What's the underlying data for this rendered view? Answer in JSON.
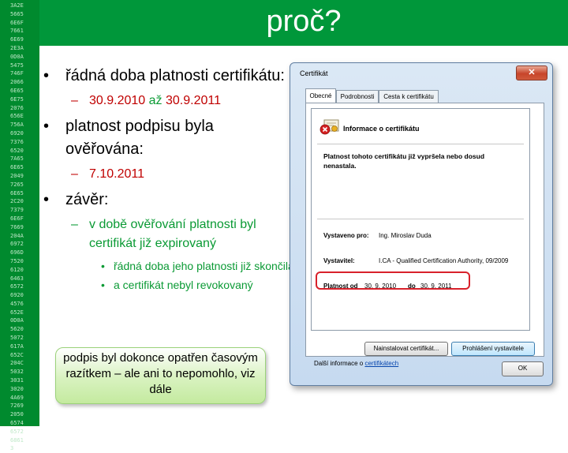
{
  "hex_strip": [
    "3A2E",
    "5665",
    "6E6F",
    "7661",
    "6E69",
    "2E3A",
    "0D0A",
    "5475",
    "746F",
    "2066",
    "6E65",
    "6E75",
    "2076",
    "656E",
    "756A",
    "6920",
    "7376",
    "6520",
    "7A65",
    "6E65",
    "2049",
    "7265",
    "6E65",
    "2C20",
    "7379",
    "6E6F",
    "7669",
    "204A",
    "6972",
    "696D",
    "7520",
    "6120",
    "6463",
    "6572",
    "6920",
    "4576",
    "652E",
    "0D0A",
    "5620",
    "5072",
    "617A",
    "652C",
    "204C",
    "5032",
    "3031",
    "3020",
    "4A69",
    "7269",
    "2050",
    "6574",
    "6572",
    "6861",
    "3"
  ],
  "title": "proč?",
  "bullets": [
    {
      "text": "řádná doba platnosti certifikátu:",
      "sub": {
        "parts": [
          "30.9.2010",
          " až ",
          "30.9.2011"
        ]
      }
    },
    {
      "text": "platnost podpisu byla ověřována:",
      "sub": {
        "parts": [
          "7.10.2011"
        ]
      }
    },
    {
      "text": "závěr:",
      "sub": {
        "text": "v době ověřování platnosti byl certifikát již expirovaný",
        "items": [
          "řádná doba jeho platnosti již skončila",
          "a certifikát nebyl revokovaný"
        ]
      }
    }
  ],
  "callout": "podpis byl dokonce opatřen časovým razítkem – ale ani to nepomohlo, viz dále",
  "dialog": {
    "title": "Certifikát",
    "close": "✕",
    "tabs": [
      "Obecné",
      "Podrobnosti",
      "Cesta k certifikátu"
    ],
    "info_title": "Informace o certifikátu",
    "warning": "Platnost tohoto certifikátu již vypršela nebo dosud nenastala.",
    "issued_to_label": "Vystaveno pro:",
    "issued_to_value": "Ing. Miroslav Duda",
    "issuer_label": "Vystavitel:",
    "issuer_value": "I.CA - Qualified Certification Authority, 09/2009",
    "valid_from_label": "Platnost od",
    "valid_from_value": "30. 9. 2010",
    "valid_to_label": "do",
    "valid_to_value": "30. 9. 2011",
    "install_button": "Nainstalovat certifikát...",
    "issuer_statement_button": "Prohlášení vystavitele",
    "more_info_text": "Další informace o ",
    "more_info_link": "certifikátech",
    "ok_button": "OK"
  }
}
